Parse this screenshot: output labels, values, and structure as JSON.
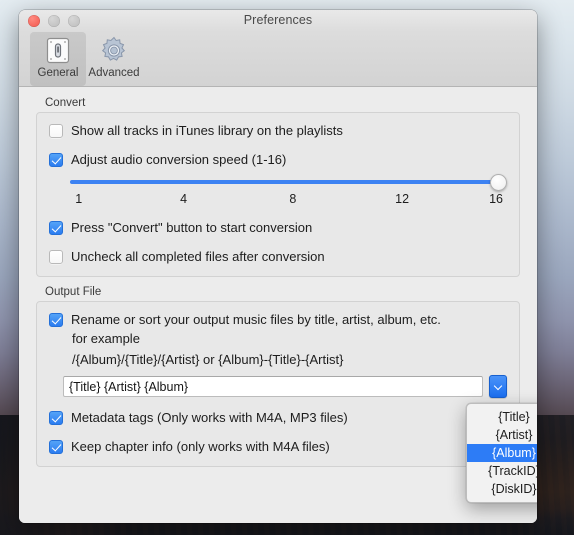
{
  "window": {
    "title": "Preferences",
    "traffic_lights": [
      "close-button",
      "minimize-button",
      "maximize-button"
    ]
  },
  "toolbar": {
    "items": [
      {
        "label": "General",
        "icon": "general-icon",
        "selected": true
      },
      {
        "label": "Advanced",
        "icon": "gear-icon",
        "selected": false
      }
    ]
  },
  "convert": {
    "group_title": "Convert",
    "options": [
      {
        "label": "Show all tracks in iTunes library on the playlists",
        "checked": false
      },
      {
        "label": "Adjust audio conversion speed (1-16)",
        "checked": true
      },
      {
        "label": "Press \"Convert\" button to start conversion",
        "checked": true
      },
      {
        "label": "Uncheck all completed files after conversion",
        "checked": false
      }
    ],
    "slider": {
      "min": 1,
      "max": 16,
      "value": 16,
      "ticks": [
        "1",
        "4",
        "8",
        "12",
        "16"
      ],
      "tick_positions": [
        0,
        24.5,
        51,
        76.5,
        99
      ],
      "track_color": "#3d82f2"
    }
  },
  "output_file": {
    "group_title": "Output File",
    "rename_option": {
      "label": "Rename or sort your output music files by title, artist, album, etc.",
      "checked": true
    },
    "example_label": "for example",
    "example_pattern": "/{Album}/{Title}/{Artist} or {Album}-{Title}-{Artist}",
    "pattern_field": {
      "value": "{Title} {Artist} {Album}",
      "placeholder": "{Title} {Artist} {Album}"
    },
    "dropdown_button": {
      "icon": "chevron-down-icon",
      "state": "active",
      "color": "#2b7cf0"
    },
    "options": [
      {
        "label": "Metadata tags (Only works with M4A, MP3 files)",
        "checked": true
      },
      {
        "label": "Keep chapter info (only works with  M4A files)",
        "checked": true
      }
    ]
  },
  "popup_menu": {
    "items": [
      {
        "label": "{Title}",
        "selected": false
      },
      {
        "label": "{Artist}",
        "selected": false
      },
      {
        "label": "{Album}",
        "selected": true
      },
      {
        "label": "{TrackID}",
        "selected": false
      },
      {
        "label": "{DiskID}",
        "selected": false
      }
    ],
    "highlight_color": "#2d7cf6"
  }
}
